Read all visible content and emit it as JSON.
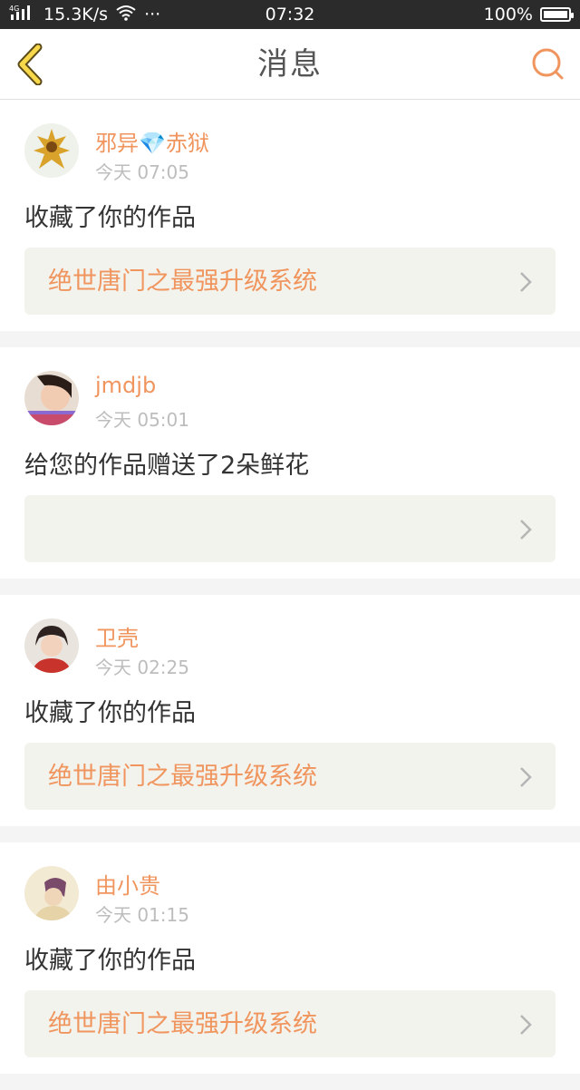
{
  "status_bar": {
    "network": "4G",
    "speed": "15.3K/s",
    "dots": "···",
    "time": "07:32",
    "battery": "100%",
    "battery_level": 1.0
  },
  "header": {
    "title": "消息",
    "back_icon": "back-chevron-icon",
    "search_icon": "search-icon",
    "accent_color": "#f0955e"
  },
  "messages": [
    {
      "username": "邪异💎赤狱",
      "time": "今天 07:05",
      "action": "收藏了你的作品",
      "work_title": "绝世唐门之最强升级系统"
    },
    {
      "username": "jmdjb",
      "time": "今天 05:01",
      "action": "给您的作品赠送了2朵鲜花",
      "work_title": ""
    },
    {
      "username": "卫壳",
      "time": "今天 02:25",
      "action": "收藏了你的作品",
      "work_title": "绝世唐门之最强升级系统"
    },
    {
      "username": "由小贵",
      "time": "今天 01:15",
      "action": "收藏了你的作品",
      "work_title": "绝世唐门之最强升级系统"
    }
  ]
}
